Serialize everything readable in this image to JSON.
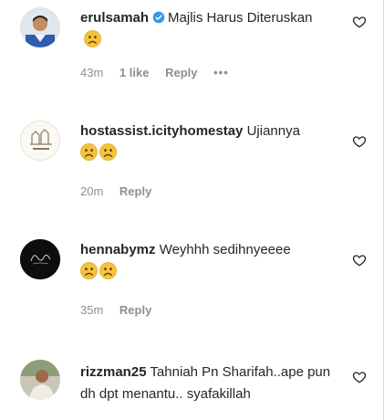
{
  "comments": [
    {
      "username": "erulsamah",
      "verified": true,
      "text": "Majlis Harus Diteruskan",
      "emoji": [
        "sad-face"
      ],
      "time": "43m",
      "likes": "1 like",
      "reply": "Reply",
      "more": "•••"
    },
    {
      "username": "hostassist.icityhomestay",
      "text": "Ujiannya",
      "emoji": [
        "sad-face",
        "sad-face"
      ],
      "time": "20m",
      "reply": "Reply"
    },
    {
      "username": "hennabymz",
      "text": "Weyhhh sedihnyeeee",
      "emoji": [
        "sad-face",
        "sad-face"
      ],
      "time": "35m",
      "reply": "Reply"
    },
    {
      "username": "rizzman25",
      "text": "Tahniah Pn Sharifah..ape pun dh dpt menantu.. syafakillah"
    }
  ],
  "colors": {
    "verified": "#3897f0",
    "muted": "#8e8e8e",
    "emoji": "#f5c33b"
  },
  "icons": {
    "like": "heart-outline-icon",
    "verified": "verified-badge-icon",
    "emoji": "sad-face-emoji-icon"
  }
}
